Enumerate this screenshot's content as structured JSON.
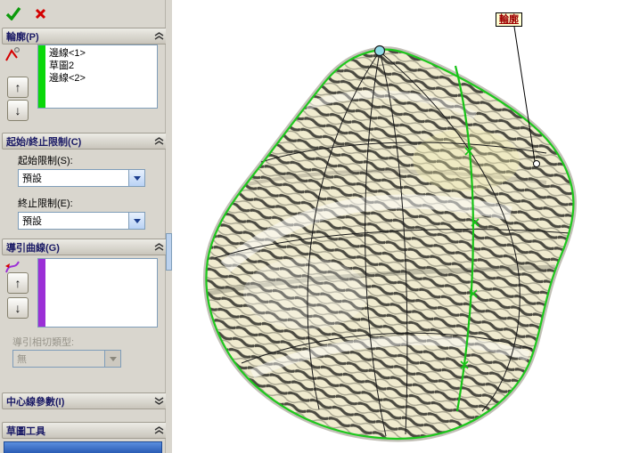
{
  "icons": {
    "up": "↑",
    "down": "↓"
  },
  "profiles": {
    "title": "輪廓(P)",
    "items": [
      "邊線<1>",
      "草圖2",
      "邊線<2>"
    ]
  },
  "limits": {
    "title": "起始/終止限制(C)",
    "start_label": "起始限制(S):",
    "start_value": "預設",
    "end_label": "終止限制(E):",
    "end_value": "預設"
  },
  "guides": {
    "title": "導引曲線(G)",
    "tangent_label": "導引相切類型:",
    "tangent_value": "無"
  },
  "centerline": {
    "title": "中心線參數(I)"
  },
  "sketch_tools": {
    "title": "草圖工具"
  },
  "viewport": {
    "callout": "輪廓"
  },
  "colors": {
    "accent_green": "#0ad80a",
    "accent_purple": "#9b2fd6",
    "edge_green": "#1dc81d",
    "vertex_cyan": "#8fdbe8"
  }
}
